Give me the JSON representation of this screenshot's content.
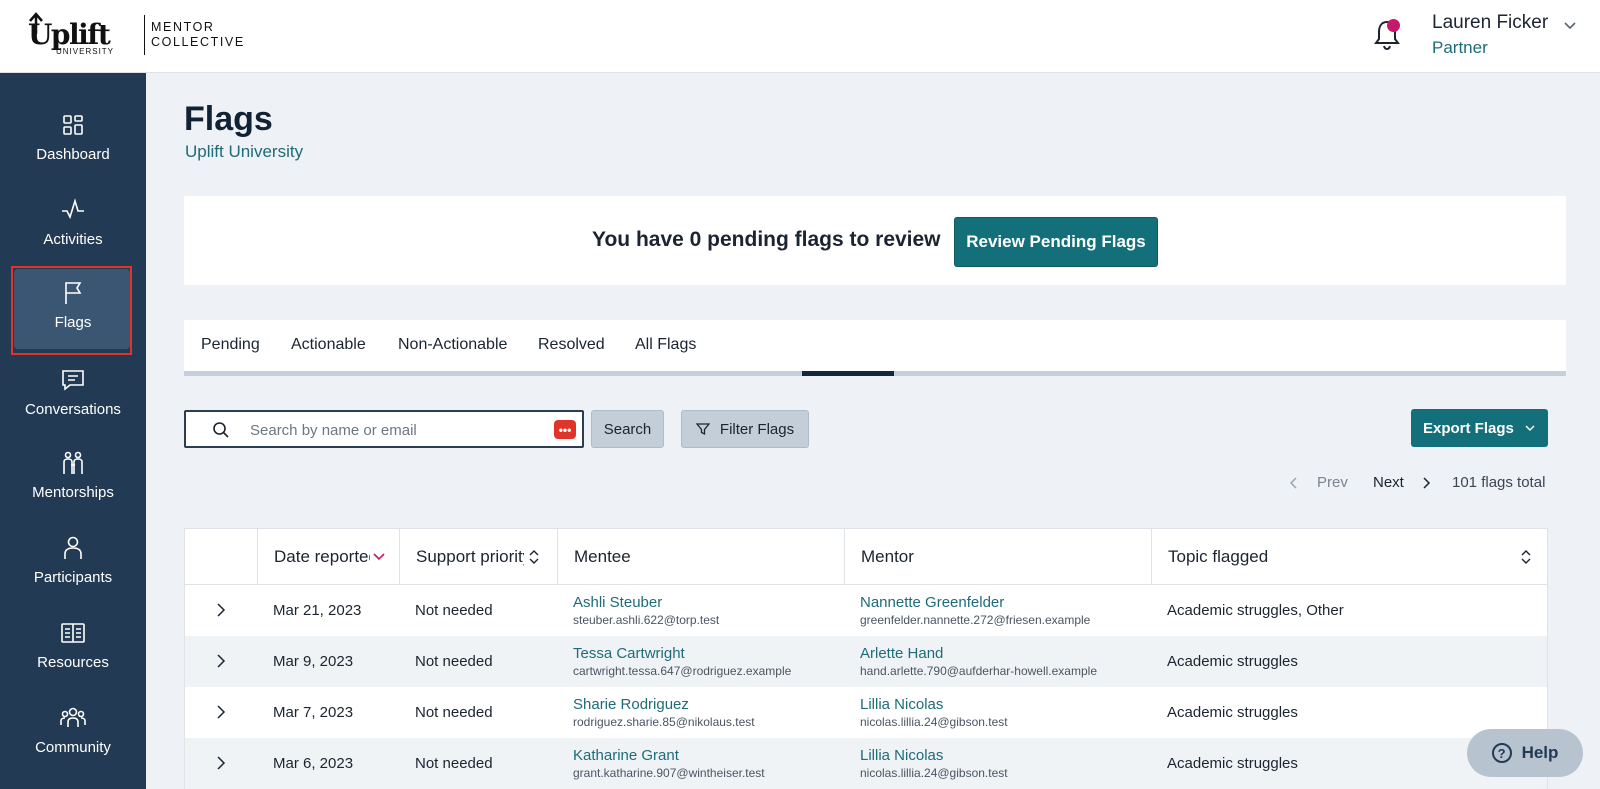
{
  "header": {
    "logo_word": "Uplift",
    "logo_sub": "UNIVERSITY",
    "logo_mentor_line1": "MENTOR",
    "logo_mentor_line2": "COLLECTIVE",
    "user_name": "Lauren Ficker",
    "user_role": "Partner",
    "notification_dot_color": "#c7186b"
  },
  "sidebar": {
    "items": [
      {
        "label": "Dashboard",
        "icon": "dashboard-icon"
      },
      {
        "label": "Activities",
        "icon": "activity-icon"
      },
      {
        "label": "Flags",
        "icon": "flag-icon",
        "active": true
      },
      {
        "label": "Conversations",
        "icon": "chat-icon"
      },
      {
        "label": "Mentorships",
        "icon": "mentorship-icon"
      },
      {
        "label": "Participants",
        "icon": "person-icon"
      },
      {
        "label": "Resources",
        "icon": "book-icon"
      },
      {
        "label": "Community",
        "icon": "group-icon"
      }
    ]
  },
  "page": {
    "title": "Flags",
    "subtitle": "Uplift University"
  },
  "pending": {
    "text": "You have 0 pending flags to review",
    "button": "Review Pending Flags"
  },
  "tabs": [
    {
      "label": "Pending"
    },
    {
      "label": "Actionable"
    },
    {
      "label": "Non-Actionable"
    },
    {
      "label": "Resolved"
    },
    {
      "label": "All Flags",
      "active": true
    }
  ],
  "toolbar": {
    "search_placeholder": "Search by name or email",
    "search_value": "",
    "badge_text": "•••",
    "search_button": "Search",
    "filter_button": "Filter Flags",
    "export_button": "Export Flags"
  },
  "pagination": {
    "prev": "Prev",
    "next": "Next",
    "total": "101 flags total"
  },
  "table": {
    "columns": [
      "Date reported",
      "Support priority",
      "Mentee",
      "Mentor",
      "Topic flagged"
    ],
    "rows": [
      {
        "date": "Mar 21, 2023",
        "priority": "Not needed",
        "mentee": "Ashli Steuber",
        "mentee_email": "steuber.ashli.622@torp.test",
        "mentor": "Nannette Greenfelder",
        "mentor_email": "greenfelder.nannette.272@friesen.example",
        "topic": "Academic struggles, Other"
      },
      {
        "date": "Mar 9, 2023",
        "priority": "Not needed",
        "mentee": "Tessa Cartwright",
        "mentee_email": "cartwright.tessa.647@rodriguez.example",
        "mentor": "Arlette Hand",
        "mentor_email": "hand.arlette.790@aufderhar-howell.example",
        "topic": "Academic struggles"
      },
      {
        "date": "Mar 7, 2023",
        "priority": "Not needed",
        "mentee": "Sharie Rodriguez",
        "mentee_email": "rodriguez.sharie.85@nikolaus.test",
        "mentor": "Lillia Nicolas",
        "mentor_email": "nicolas.lillia.24@gibson.test",
        "topic": "Academic struggles"
      },
      {
        "date": "Mar 6, 2023",
        "priority": "Not needed",
        "mentee": "Katharine Grant",
        "mentee_email": "grant.katharine.907@wintheiser.test",
        "mentor": "Lillia Nicolas",
        "mentor_email": "nicolas.lillia.24@gibson.test",
        "topic": "Academic struggles"
      }
    ]
  },
  "help": {
    "label": "Help"
  },
  "colors": {
    "sidebar": "#233a54",
    "accent": "#13707a",
    "link": "#1f6b78"
  }
}
